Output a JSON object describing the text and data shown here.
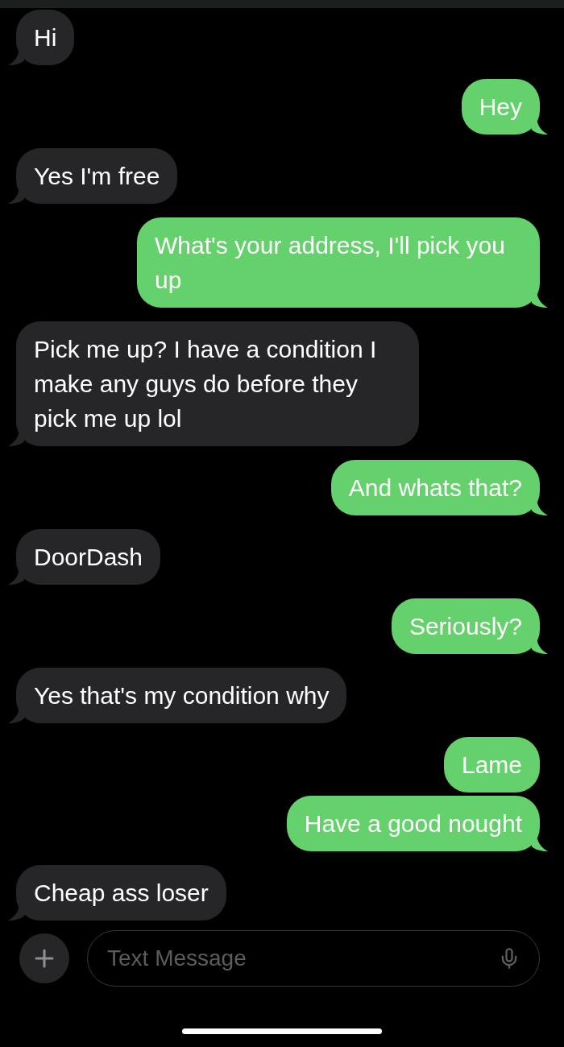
{
  "messages": [
    {
      "text": "Hi",
      "kind": "incoming",
      "tail": true
    },
    {
      "text": "Hey",
      "kind": "outgoing",
      "tail": true
    },
    {
      "text": "Yes I'm free",
      "kind": "incoming",
      "tail": true
    },
    {
      "text": "What's your address, I'll pick you up",
      "kind": "outgoing",
      "tail": true
    },
    {
      "text": "Pick me up? I have a condition I make any guys do before they pick me up lol",
      "kind": "incoming",
      "tail": true
    },
    {
      "text": "And whats that?",
      "kind": "outgoing",
      "tail": true
    },
    {
      "text": "DoorDash",
      "kind": "incoming",
      "tail": true
    },
    {
      "text": "Seriously?",
      "kind": "outgoing",
      "tail": true
    },
    {
      "text": "Yes that's my condition why",
      "kind": "incoming",
      "tail": true
    },
    {
      "text": "Lame",
      "kind": "outgoing",
      "tail": false
    },
    {
      "text": "Have a good nought",
      "kind": "outgoing",
      "tail": true
    },
    {
      "text": "Cheap ass loser",
      "kind": "incoming",
      "tail": true
    }
  ],
  "composer": {
    "placeholder": "Text Message"
  }
}
